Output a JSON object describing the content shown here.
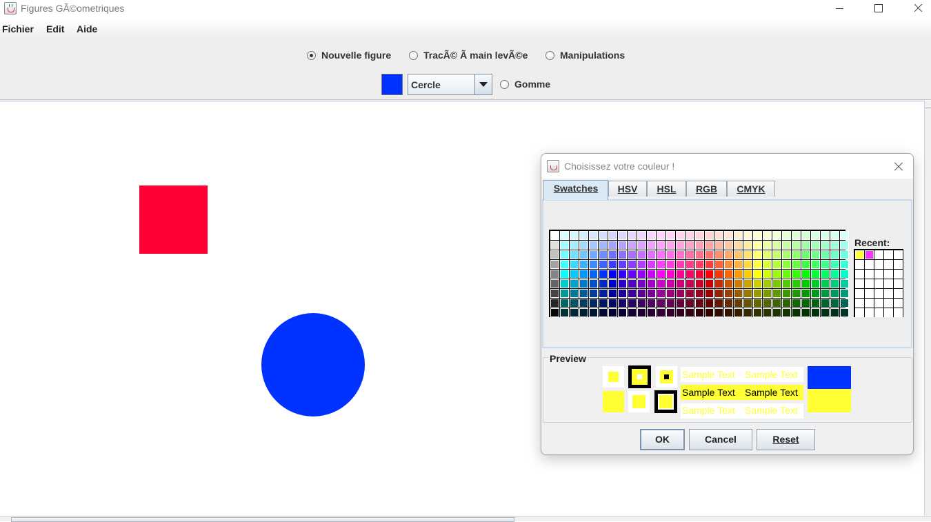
{
  "window": {
    "title": "Figures GÃ©ometriques"
  },
  "menubar": {
    "items": [
      "Fichier",
      "Edit",
      "Aide"
    ]
  },
  "toolbar": {
    "mode_options": [
      {
        "label": "Nouvelle figure",
        "selected": true
      },
      {
        "label": "TracÃ© Ã  main levÃ©e",
        "selected": false
      },
      {
        "label": "Manipulations",
        "selected": false
      }
    ],
    "current_color": "#0033ff",
    "shape_select_value": "Cercle",
    "eraser_label": "Gomme"
  },
  "canvas": {
    "shapes": [
      {
        "type": "square",
        "color": "#ff0033"
      },
      {
        "type": "circle",
        "color": "#0033ff"
      }
    ]
  },
  "color_dialog": {
    "title": "Choisissez votre couleur !",
    "tabs": [
      {
        "label": "Swatches",
        "active": true
      },
      {
        "label": "HSV",
        "active": false
      },
      {
        "label": "HSL",
        "active": false
      },
      {
        "label": "RGB",
        "active": false
      },
      {
        "label": "CMYK",
        "active": false
      }
    ],
    "recent_label": "Recent:",
    "recent_colors": [
      "#ffff33",
      "#ff33ff"
    ],
    "preview_label": "Preview",
    "preview_text": "Sample Text",
    "preview_foreground": "#ffff33",
    "preview_background": "#0033ff",
    "buttons": {
      "ok": "OK",
      "cancel": "Cancel",
      "reset": "Reset"
    }
  }
}
